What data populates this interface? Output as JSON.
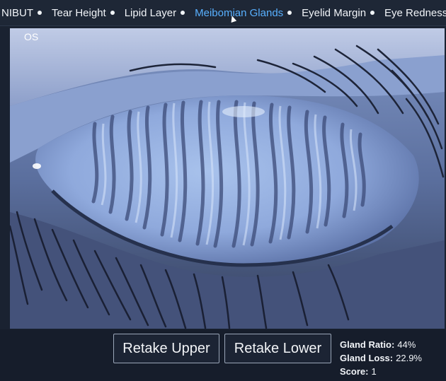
{
  "nav": {
    "tabs": [
      {
        "label": "NIBUT",
        "active": false
      },
      {
        "label": "Tear Height",
        "active": false
      },
      {
        "label": "Lipid Layer",
        "active": false
      },
      {
        "label": "Meibomian Glands",
        "active": true
      },
      {
        "label": "Eyelid Margin",
        "active": false
      },
      {
        "label": "Eye Redness",
        "active": false
      }
    ]
  },
  "image": {
    "eye_label": "OS"
  },
  "controls": {
    "retake_upper_label": "Retake Upper",
    "retake_lower_label": "Retake Lower"
  },
  "stats": {
    "gland_ratio_label": "Gland Ratio:",
    "gland_ratio_value": "44%",
    "gland_loss_label": "Gland Loss:",
    "gland_loss_value": "22.9%",
    "score_label": "Score:",
    "score_value": "1"
  },
  "colors": {
    "active_tab": "#58b0ff",
    "background": "#1a2231",
    "tint": "#8aa8e0"
  }
}
